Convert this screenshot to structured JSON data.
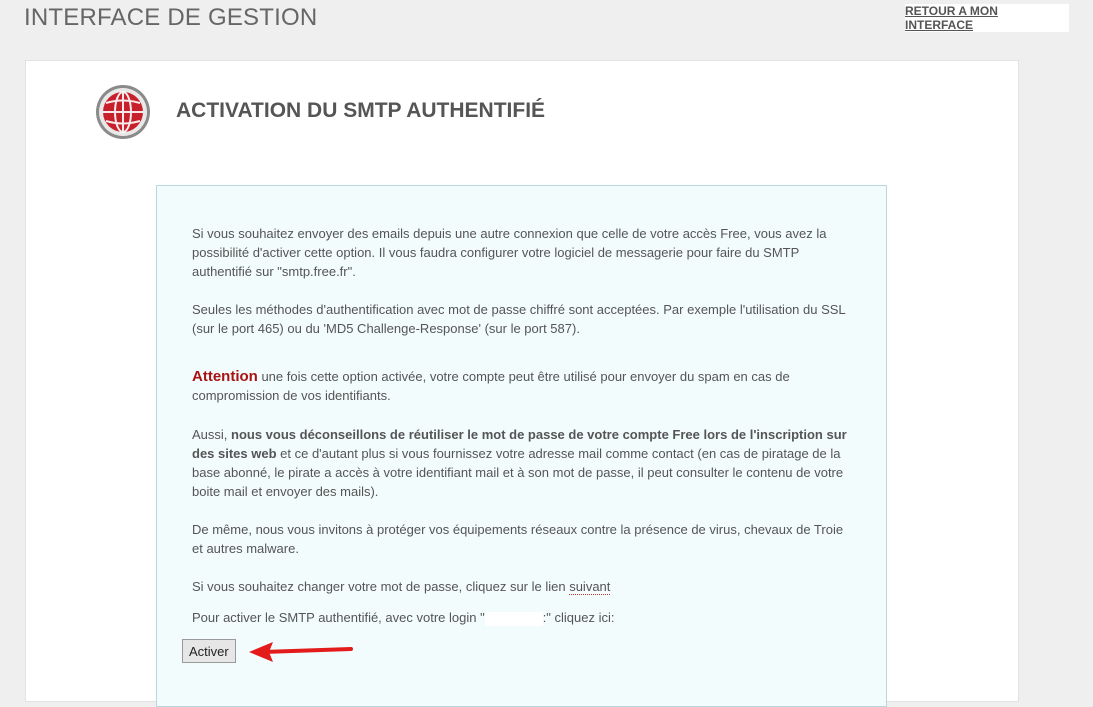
{
  "header": {
    "title": "INTERFACE DE GESTION",
    "return_link": "RETOUR A MON INTERFACE"
  },
  "section": {
    "title": "ACTIVATION DU SMTP AUTHENTIFIÉ",
    "icon": "globe-icon"
  },
  "content": {
    "p1": "Si vous souhaitez envoyer des emails depuis une autre connexion que celle de votre accès Free, vous avez la possibilité d'activer cette option. Il vous faudra configurer votre logiciel de messagerie pour faire du SMTP authentifié sur \"smtp.free.fr\".",
    "p2": "Seules les méthodes d'authentification avec mot de passe chiffré sont acceptées. Par exemple l'utilisation du SSL (sur le port 465) ou du 'MD5 Challenge-Response' (sur le port 587).",
    "attention_label": "Attention",
    "p3_rest": " une fois cette option activée, votre compte peut être utilisé pour envoyer du spam en cas de compromission de vos identifiants.",
    "p4_start": "Aussi, ",
    "p4_strong": "nous vous déconseillons de réutiliser le mot de passe de votre compte Free lors de l'inscription sur des sites web",
    "p4_rest": " et ce d'autant plus si vous fournissez votre adresse mail comme contact (en cas de piratage de la base abonné, le pirate a accès à votre identifiant mail et à son mot de passe, il peut consulter le contenu de votre boite mail et envoyer des mails).",
    "p5": "De même, nous vous invitons à protéger vos équipements réseaux contre la présence de virus, chevaux de Troie et autres malware.",
    "p6_text": "Si vous souhaitez changer votre mot de passe, cliquez sur le lien ",
    "p6_link": "suivant",
    "p7_start": "Pour activer le SMTP authentifié, avec votre login \"",
    "p7_end": ":\" cliquez ici:"
  },
  "button": {
    "activate_label": "Activer"
  },
  "colors": {
    "attention": "#aa1111",
    "arrow": "#e31b1b",
    "box_bg": "#f2fcfd"
  }
}
